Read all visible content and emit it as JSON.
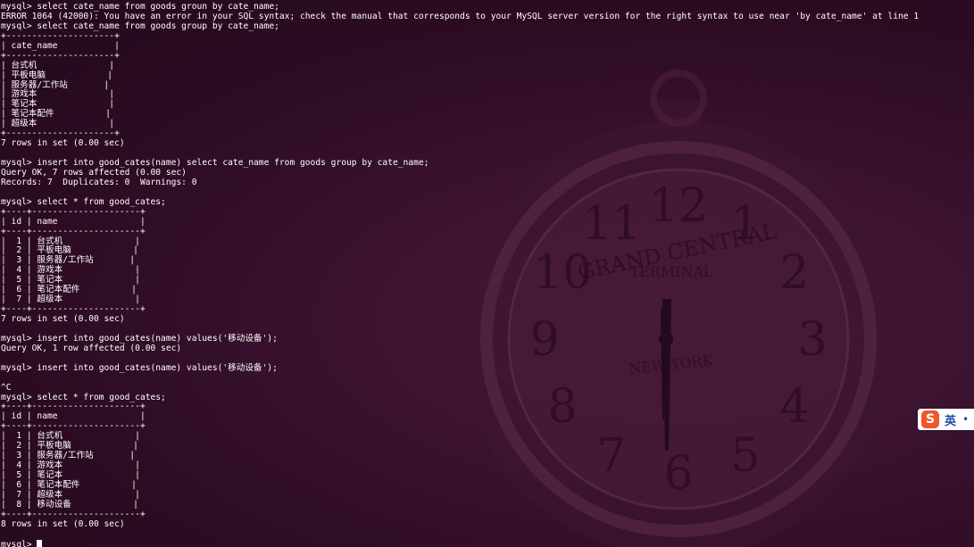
{
  "terminal": {
    "lines": [
      "mysql> select cate_name from goods groun by cate_name;",
      "ERROR 1064 (42000): You have an error in your SQL syntax; check the manual that corresponds to your MySQL server version for the right syntax to use near 'by cate_name' at line 1",
      "mysql> select cate_name from goods group by cate_name;",
      "+---------------------+",
      "| cate_name           |",
      "+---------------------+",
      "| 台式机              |",
      "| 平板电脑            |",
      "| 服务器/工作站       |",
      "| 游戏本              |",
      "| 笔记本              |",
      "| 笔记本配件          |",
      "| 超级本              |",
      "+---------------------+",
      "7 rows in set (0.00 sec)",
      "",
      "mysql> insert into good_cates(name) select cate_name from goods group by cate_name;",
      "Query OK, 7 rows affected (0.00 sec)",
      "Records: 7  Duplicates: 0  Warnings: 0",
      "",
      "mysql> select * from good_cates;",
      "+----+---------------------+",
      "| id | name                |",
      "+----+---------------------+",
      "|  1 | 台式机              |",
      "|  2 | 平板电脑            |",
      "|  3 | 服务器/工作站       |",
      "|  4 | 游戏本              |",
      "|  5 | 笔记本              |",
      "|  6 | 笔记本配件          |",
      "|  7 | 超级本              |",
      "+----+---------------------+",
      "7 rows in set (0.00 sec)",
      "",
      "mysql> insert into good_cates(name) values('移动设备');",
      "Query OK, 1 row affected (0.00 sec)",
      "",
      "mysql> insert into good_cates(name) values('移动设备');",
      "",
      "^C",
      "mysql> select * from good_cates;",
      "+----+---------------------+",
      "| id | name                |",
      "+----+---------------------+",
      "|  1 | 台式机              |",
      "|  2 | 平板电脑            |",
      "|  3 | 服务器/工作站       |",
      "|  4 | 游戏本              |",
      "|  5 | 笔记本              |",
      "|  6 | 笔记本配件          |",
      "|  7 | 超级本              |",
      "|  8 | 移动设备            |",
      "+----+---------------------+",
      "8 rows in set (0.00 sec)",
      ""
    ],
    "prompt": "mysql> "
  },
  "wallpaper": {
    "clock_brand_top": "GRAND CENTRAL",
    "clock_brand_middle": "TERMINAL",
    "clock_brand_bottom": "NEW YORK",
    "numerals": [
      "12",
      "1",
      "2",
      "3",
      "4",
      "5",
      "6",
      "7",
      "8",
      "9",
      "10",
      "11"
    ]
  },
  "ime": {
    "logo": "S",
    "mode": "英",
    "dot": "•",
    "color_logo": "#f0572a",
    "color_text": "#1f4fa8"
  },
  "colors": {
    "background": "#300a24",
    "text": "#ffffff"
  }
}
